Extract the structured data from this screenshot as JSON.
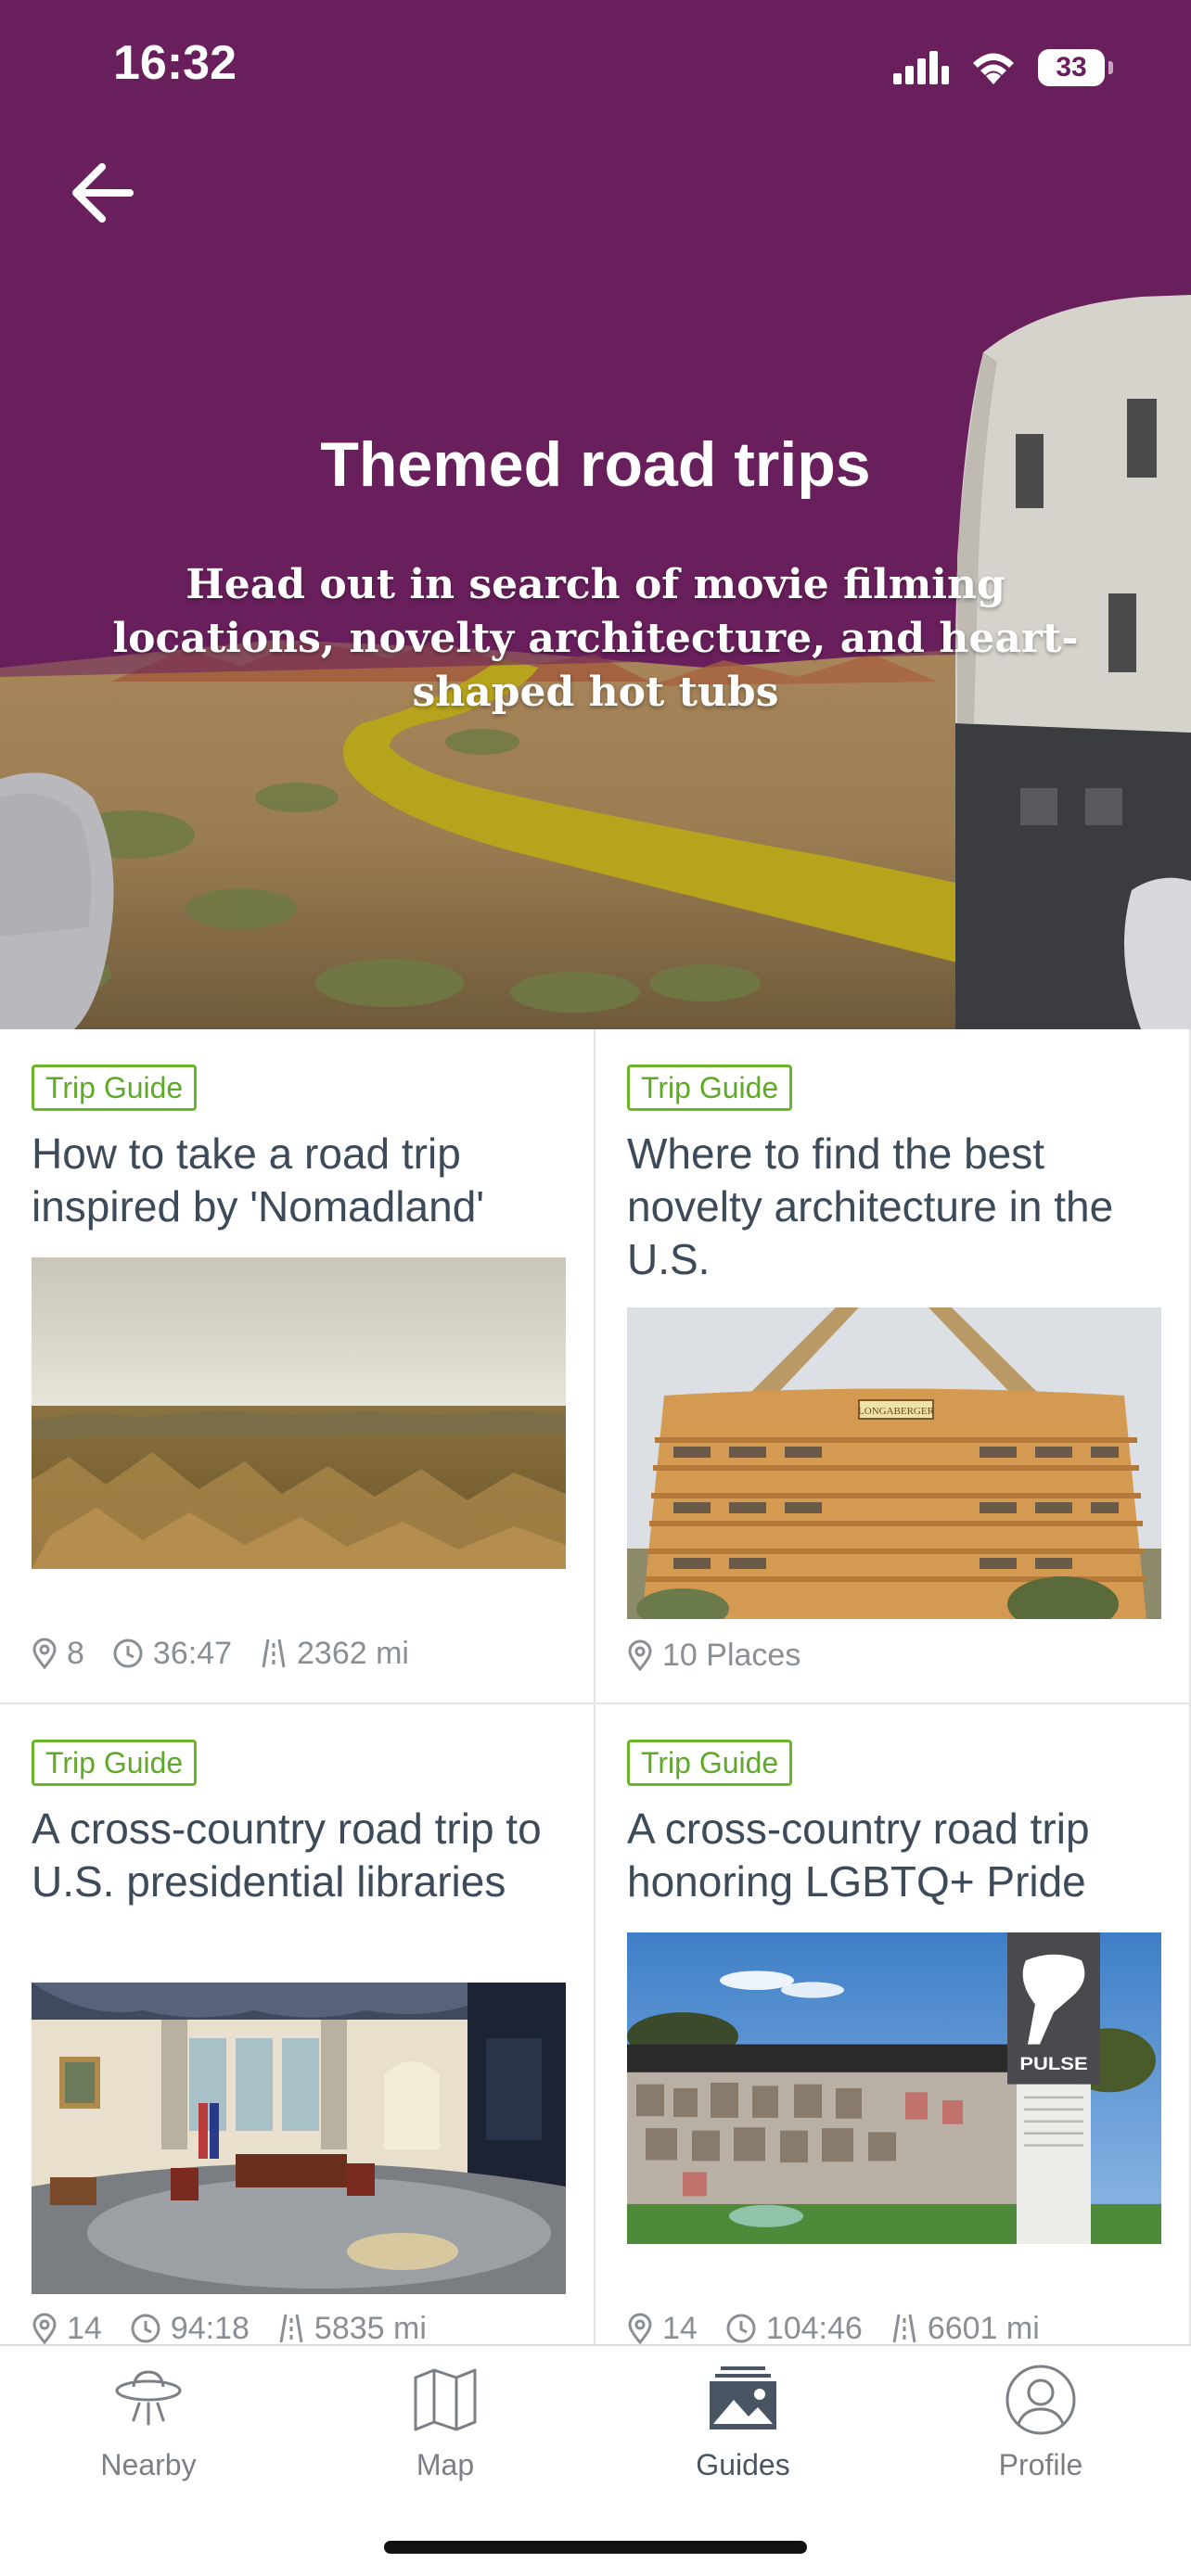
{
  "status_bar": {
    "time": "16:32",
    "battery": "33"
  },
  "colors": {
    "hero_bg": "#6a1f5d",
    "tag_green": "#6cb42b",
    "title_text": "#3c4a5a",
    "meta_text": "#8a8f96"
  },
  "hero": {
    "title": "Themed road trips",
    "subtitle": "Head out in search of movie filming locations, novelty architecture, and heart-shaped hot tubs"
  },
  "cards": [
    {
      "tag": "Trip Guide",
      "title": "How to take a road trip inspired by 'Nomadland'",
      "places": "8",
      "duration": "36:47",
      "distance": "2362 mi"
    },
    {
      "tag": "Trip Guide",
      "title": "Where to find the best novelty architecture in the U.S.",
      "places_label": "10 Places",
      "sign_text": "LONGABERGER"
    },
    {
      "tag": "Trip Guide",
      "title": "A cross-country road trip to U.S. presidential libraries",
      "places": "14",
      "duration": "94:18",
      "distance": "5835 mi"
    },
    {
      "tag": "Trip Guide",
      "title": "A cross-country road trip honoring LGBTQ+ Pride",
      "places": "14",
      "duration": "104:46",
      "distance": "6601 mi",
      "sign_text": "PULSE"
    }
  ],
  "tabs": [
    {
      "label": "Nearby",
      "icon": "ufo-icon"
    },
    {
      "label": "Map",
      "icon": "map-icon"
    },
    {
      "label": "Guides",
      "icon": "guides-icon",
      "active": true
    },
    {
      "label": "Profile",
      "icon": "profile-icon"
    }
  ]
}
